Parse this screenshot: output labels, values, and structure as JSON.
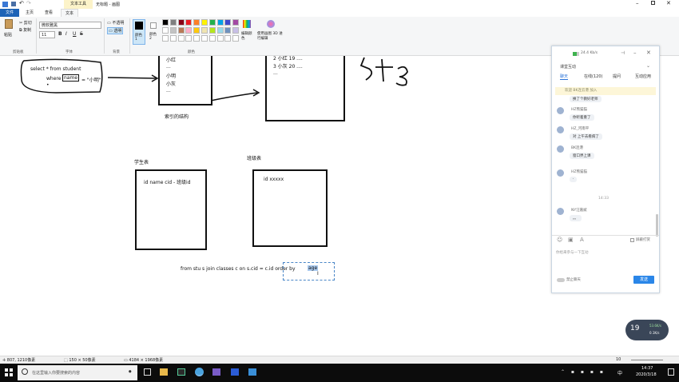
{
  "window": {
    "title": "无标题 - 画图"
  },
  "ribbon": {
    "tabs": [
      "文件",
      "主页",
      "查看",
      "文本"
    ],
    "context_tab_header": "文本工具",
    "clipboard": {
      "paste": "粘贴",
      "cut": "剪切",
      "copy": "复制",
      "group": "剪贴板"
    },
    "font": {
      "name": "微软雅黑",
      "size": "11",
      "group": "字体"
    },
    "background": {
      "opaque": "不透明",
      "transparent": "透明",
      "group": "背景"
    },
    "colors": {
      "color1": "颜色 1",
      "color2": "颜色 2",
      "edit": "编辑颜色",
      "paint3d": "使用画图 3D 进行编辑",
      "group": "颜色",
      "palette": [
        "#000000",
        "#7f7f7f",
        "#880015",
        "#ed1c24",
        "#ff7f27",
        "#fff200",
        "#22b14c",
        "#00a2e8",
        "#3f48cc",
        "#a349a4",
        "#ffffff",
        "#c3c3c3",
        "#b97a57",
        "#ffaec9",
        "#ffc90e",
        "#efe4b0",
        "#b5e61d",
        "#99d9ea",
        "#7092be",
        "#c8bfe7"
      ]
    }
  },
  "canvas": {
    "sql_line1": "select * from student",
    "sql_where": "where",
    "sql_name": "name",
    "sql_eq": "= \"小明\"",
    "index_items": [
      "小红",
      "...",
      "小明",
      "小灰",
      "..."
    ],
    "index_caption": "索引的结构",
    "table_rows": [
      "2  小红   19  ....",
      "3  小灰   20  ....",
      "..."
    ],
    "student_title": "学生表",
    "student_cols": "id  name  cid - 班级id",
    "class_title": "班级表",
    "class_cols": "id  xxxxx",
    "query_text": "from stu s join classes  c  on s.cid =  c.id  order by ",
    "query_highlight": "age"
  },
  "status": {
    "cursor": "807, 1210像素",
    "selection": "150 × 50像素",
    "image_size": "4184 × 1968像素",
    "zoom": "10"
  },
  "chat": {
    "signal": "24.4 Kb/s",
    "title": "课堂互动",
    "tabs": [
      "聊天",
      "在线(120)",
      "提问",
      "互动应用"
    ],
    "welcome": "欢迎 BK连云港 加入",
    "messages": [
      {
        "name": "",
        "text": "换了个教好老师"
      },
      {
        "name": "HZ熊猫猫",
        "text": "你听着重了"
      },
      {
        "name": "HZ_河南平",
        "text": "对 上午去看病了"
      },
      {
        "name": "BK连港",
        "text": "窗口界上课"
      },
      {
        "name": "HZ熊猫猫",
        "text": "·"
      },
      {
        "name": "NY汪嘉斌",
        "text": "。。"
      }
    ],
    "time_sep": "14:33",
    "barrage": "屏蔽打赏",
    "input_placeholder": "你给来参与一下互动",
    "mute": "禁止聊天",
    "send": "发送"
  },
  "perf": {
    "cpu": "19",
    "up": "53.6K/s",
    "down": "0.1K/s"
  },
  "taskbar": {
    "search_placeholder": "在这里输入你要搜索的内容",
    "ime": "中",
    "time": "14:37",
    "date": "2020/3/18"
  }
}
